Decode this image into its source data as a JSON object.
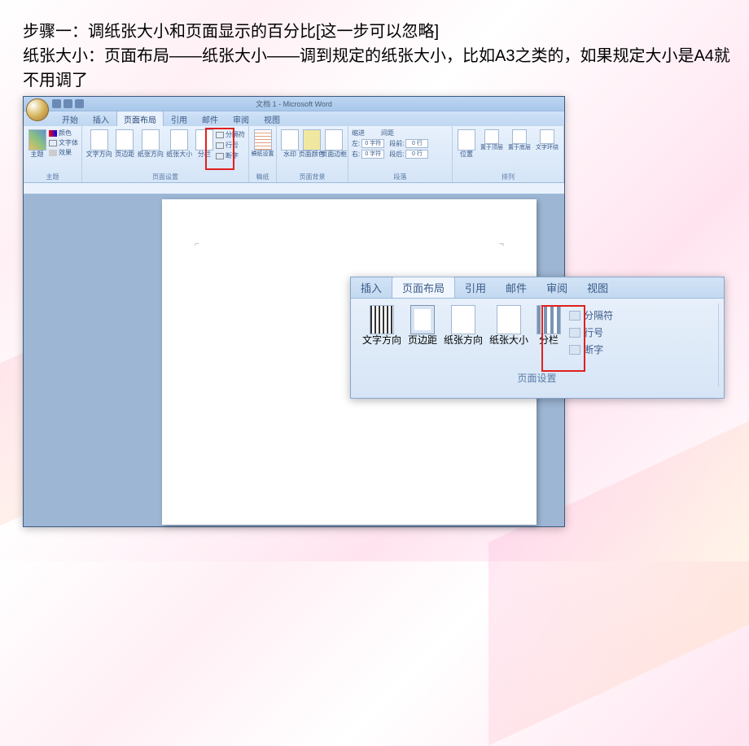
{
  "instruction": {
    "line1": "步骤一：调纸张大小和页面显示的百分比[这一步可以忽略]",
    "line2": "纸张大小：页面布局——纸张大小——调到规定的纸张大小，比如A3之类的，如果规定大小是A4就不用调了"
  },
  "word": {
    "title": "文档 1 - Microsoft Word",
    "tabs": [
      "开始",
      "插入",
      "页面布局",
      "引用",
      "邮件",
      "审阅",
      "视图"
    ],
    "active_tab_index": 2,
    "ribbon": {
      "themes": {
        "main": "主题",
        "colors": "颜色",
        "fonts": "文字体",
        "effects": "效果",
        "group": "主题"
      },
      "page_setup": {
        "text_direction": "文字方向",
        "margins": "页边距",
        "orientation": "纸张方向",
        "size": "纸张大小",
        "columns": "分栏",
        "breaks": "分隔符",
        "line_numbers": "行号",
        "hyphenation": "断字",
        "group": "页面设置"
      },
      "manuscript": {
        "settings": "稿纸设置",
        "group": "稿纸"
      },
      "page_bg": {
        "watermark": "水印",
        "color": "页面颜色",
        "borders": "页面边框",
        "group": "页面背景"
      },
      "paragraph": {
        "indent_label": "缩进",
        "indent_left_label": "左:",
        "indent_left_value": "0 字符",
        "indent_right_label": "右:",
        "indent_right_value": "0 字符",
        "spacing_label": "间距",
        "spacing_before_label": "段前:",
        "spacing_before_value": "0 行",
        "spacing_after_label": "段后:",
        "spacing_after_value": "0 行",
        "group": "段落"
      },
      "arrange": {
        "position": "位置",
        "front": "置于顶层",
        "back": "置于底层",
        "wrap": "文字环绕",
        "group": "排列"
      }
    }
  },
  "zoom": {
    "tabs": [
      "插入",
      "页面布局",
      "引用",
      "邮件",
      "审阅",
      "视图"
    ],
    "active_tab_index": 1,
    "buttons": {
      "text_direction": "文字方向",
      "margins": "页边距",
      "orientation": "纸张方向",
      "size": "纸张大小",
      "columns": "分栏"
    },
    "small": {
      "breaks": "分隔符",
      "line_numbers": "行号",
      "hyphenation": "断字"
    },
    "group_label": "页面设置"
  }
}
